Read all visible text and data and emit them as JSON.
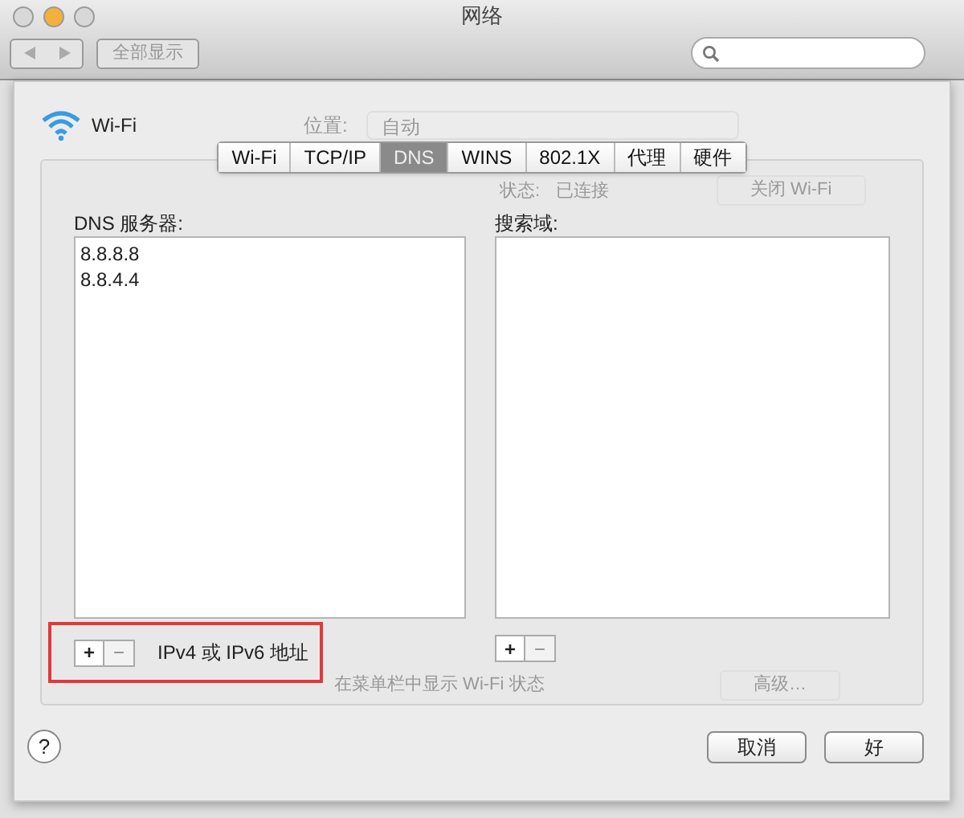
{
  "window": {
    "title": "网络"
  },
  "toolbar": {
    "show_all": "全部显示"
  },
  "background": {
    "location_label": "位置:",
    "location_value": "自动",
    "status_label": "状态:",
    "status_value": "已连接",
    "turn_off": "关闭 Wi-Fi",
    "menu_bar_option": "在菜单栏中显示 Wi-Fi 状态",
    "advanced": "高级…"
  },
  "service": {
    "name": "Wi-Fi"
  },
  "tabs": [
    {
      "label": "Wi-Fi",
      "selected": false
    },
    {
      "label": "TCP/IP",
      "selected": false
    },
    {
      "label": "DNS",
      "selected": true
    },
    {
      "label": "WINS",
      "selected": false
    },
    {
      "label": "802.1X",
      "selected": false
    },
    {
      "label": "代理",
      "selected": false
    },
    {
      "label": "硬件",
      "selected": false
    }
  ],
  "dns_servers": {
    "label": "DNS 服务器:",
    "items": [
      "8.8.8.8",
      "8.8.4.4"
    ],
    "add": "+",
    "remove": "−",
    "hint": "IPv4 或 IPv6 地址"
  },
  "search_domains": {
    "label": "搜索域:",
    "add": "+",
    "remove": "−"
  },
  "help": "?",
  "buttons": [
    "取消",
    "好"
  ]
}
